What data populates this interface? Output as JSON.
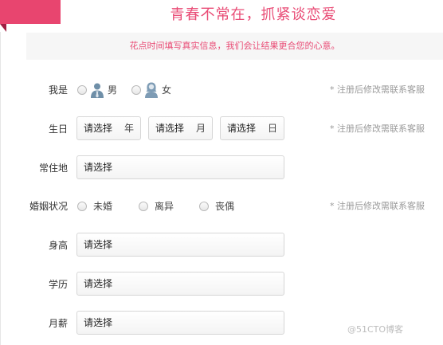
{
  "header": {
    "title": "青春不常在，抓紧谈恋爱",
    "notice": "花点时间填写真实信息，我们会让结果更合您的心意。"
  },
  "form": {
    "gender": {
      "label": "我是",
      "options": [
        "男",
        "女"
      ],
      "hint": "* 注册后修改需联系客服"
    },
    "birthday": {
      "label": "生日",
      "year": {
        "placeholder": "请选择",
        "unit": "年"
      },
      "month": {
        "placeholder": "请选择",
        "unit": "月"
      },
      "day": {
        "placeholder": "请选择",
        "unit": "日"
      },
      "hint": "* 注册后修改需联系客服"
    },
    "residence": {
      "label": "常住地",
      "placeholder": "请选择"
    },
    "marital": {
      "label": "婚姻状况",
      "options": [
        "未婚",
        "离异",
        "丧偶"
      ],
      "hint": "* 注册后修改需联系客服"
    },
    "height": {
      "label": "身高",
      "placeholder": "请选择"
    },
    "education": {
      "label": "学历",
      "placeholder": "请选择"
    },
    "salary": {
      "label": "月薪",
      "placeholder": "请选择"
    }
  },
  "watermark": "@51CTO博客",
  "colors": {
    "accent": "#e94c76",
    "accent_dark": "#9e1f42",
    "hint": "#999999",
    "notice_bg": "#f6f6f6"
  }
}
